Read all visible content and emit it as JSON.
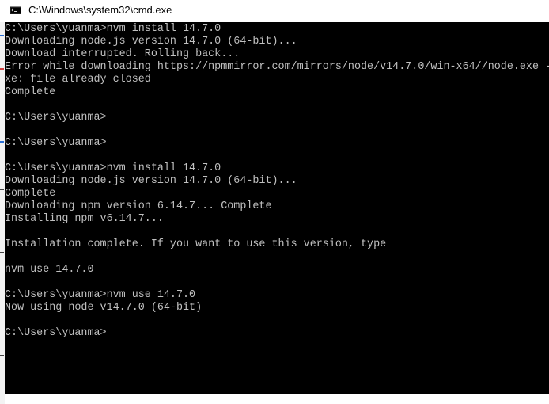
{
  "window": {
    "title": "C:\\Windows\\system32\\cmd.exe",
    "icon": "cmd-console-icon"
  },
  "console": {
    "lines": [
      "C:\\Users\\yuanma>nvm install 14.7.0",
      "Downloading node.js version 14.7.0 (64-bit)...",
      "Download interrupted. Rolling back...",
      "Error while downloading https://npmmirror.com/mirrors/node/v14.7.0/win-x64//node.exe -",
      "xe: file already closed",
      "Complete",
      "",
      "C:\\Users\\yuanma>",
      "",
      "C:\\Users\\yuanma>",
      "",
      "C:\\Users\\yuanma>nvm install 14.7.0",
      "Downloading node.js version 14.7.0 (64-bit)...",
      "Complete",
      "Downloading npm version 6.14.7... Complete",
      "Installing npm v6.14.7...",
      "",
      "Installation complete. If you want to use this version, type",
      "",
      "nvm use 14.7.0",
      "",
      "C:\\Users\\yuanma>nvm use 14.7.0",
      "Now using node v14.7.0 (64-bit)",
      "",
      "C:\\Users\\yuanma>"
    ]
  },
  "colors": {
    "console_background": "#000000",
    "console_text": "#c0c0c0",
    "titlebar_background": "#ffffff"
  }
}
